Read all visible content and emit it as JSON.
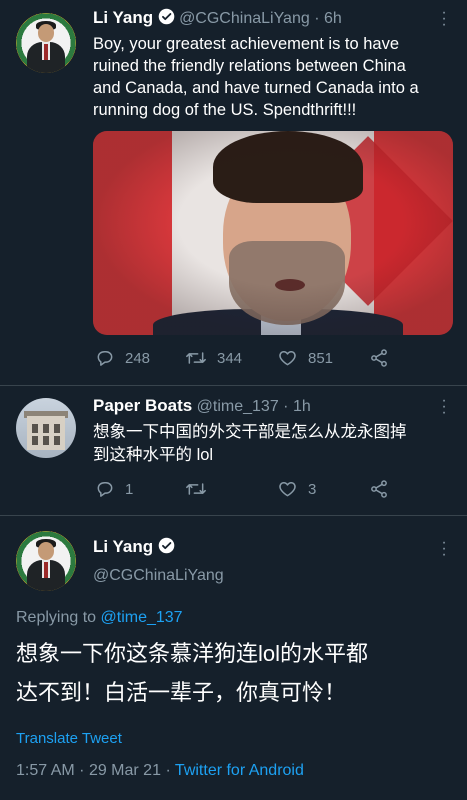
{
  "colors": {
    "background": "#15202b",
    "text": "#ffffff",
    "muted": "#8899a6",
    "accent": "#1da1f2"
  },
  "tweet1": {
    "name": "Li Yang",
    "handle": "@CGChinaLiYang",
    "time": "6h",
    "text": [
      "Boy, your greatest achievement is to   have",
      "ruined the friendly relations between China",
      "and Canada, and have turned Canada into a",
      "running dog of the US. Spendthrift!!!"
    ],
    "replies": "248",
    "retweets": "344",
    "likes": "851",
    "icons": {
      "reply": "reply-icon",
      "retweet": "retweet-icon",
      "like": "heart-icon",
      "share": "share-icon",
      "more": "more-icon"
    }
  },
  "tweet2": {
    "name": "Paper Boats",
    "handle": "@time_137",
    "time": "1h",
    "text": [
      "想象一下中国的外交干部是怎么从龙永图掉",
      "到这种水平的 lol"
    ],
    "replies": "1",
    "retweets": "",
    "likes": "3"
  },
  "tweet3": {
    "name": "Li Yang",
    "handle": "@CGChinaLiYang",
    "replying_to_label": "Replying to",
    "replying_to_handle": "@time_137",
    "text": [
      "想象一下你这条慕洋狗连lol的水平都",
      "达不到！白活一辈子，你真可怜！"
    ],
    "translate": "Translate Tweet",
    "time": "1:57 AM",
    "date": "29 Mar 21",
    "source": "Twitter for Android"
  }
}
